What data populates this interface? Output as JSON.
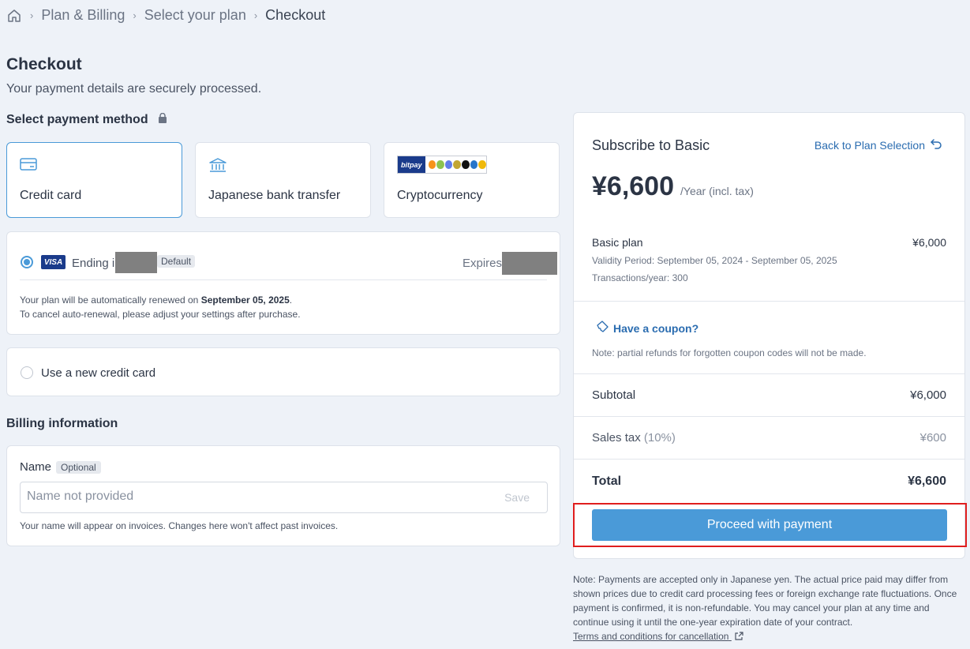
{
  "breadcrumb": {
    "items": [
      "Plan & Billing",
      "Select your plan"
    ],
    "current": "Checkout"
  },
  "header": {
    "title": "Checkout",
    "subtitle": "Your payment details are securely processed."
  },
  "payment": {
    "section_title": "Select payment method",
    "methods": [
      {
        "label": "Credit card",
        "icon": "credit-card-icon",
        "active": true
      },
      {
        "label": "Japanese bank transfer",
        "icon": "bank-icon",
        "active": false
      },
      {
        "label": "Cryptocurrency",
        "icon": "bitpay-logo",
        "active": false
      }
    ],
    "crypto_logo_text": "bitpay",
    "saved_card": {
      "brand": "VISA",
      "ending_label": "Ending in",
      "default_badge": "Default",
      "expires_label": "Expires",
      "renew_prefix": "Your plan will be automatically renewed on ",
      "renew_date": "September 05, 2025",
      "renew_suffix": ".",
      "cancel_note": "To cancel auto-renewal, please adjust your settings after purchase."
    },
    "new_card_label": "Use a new credit card"
  },
  "billing": {
    "section_title": "Billing information",
    "name_label": "Name",
    "optional_badge": "Optional",
    "name_placeholder": "Name not provided",
    "name_value": "",
    "save_label": "Save",
    "name_help": "Your name will appear on invoices. Changes here won't affect past invoices."
  },
  "summary": {
    "title": "Subscribe to Basic",
    "back_link": "Back to Plan Selection",
    "price": "¥6,600",
    "price_period": "/Year (incl. tax)",
    "plan_name": "Basic plan",
    "plan_price": "¥6,000",
    "validity": "Validity Period: September 05, 2024 - September 05, 2025",
    "transactions": "Transactions/year: 300",
    "coupon_link": "Have a coupon?",
    "coupon_note": "Note: partial refunds for forgotten coupon codes will not be made.",
    "subtotal_label": "Subtotal",
    "subtotal_value": "¥6,000",
    "tax_label": "Sales tax",
    "tax_rate": "(10%)",
    "tax_value": "¥600",
    "total_label": "Total",
    "total_value": "¥6,600",
    "proceed_label": "Proceed with payment"
  },
  "footnote": {
    "text": "Note: Payments are accepted only in Japanese yen. The actual price paid may differ from shown prices due to credit card processing fees or foreign exchange rate fluctuations. Once payment is confirmed, it is non-refundable. You may cancel your plan at any time and continue using it until the one-year expiration date of your contract.",
    "terms_link": "Terms and conditions for cancellation"
  },
  "colors": {
    "accent": "#4a9ad8",
    "highlight": "#e01e1e",
    "background": "#eef2f8"
  }
}
